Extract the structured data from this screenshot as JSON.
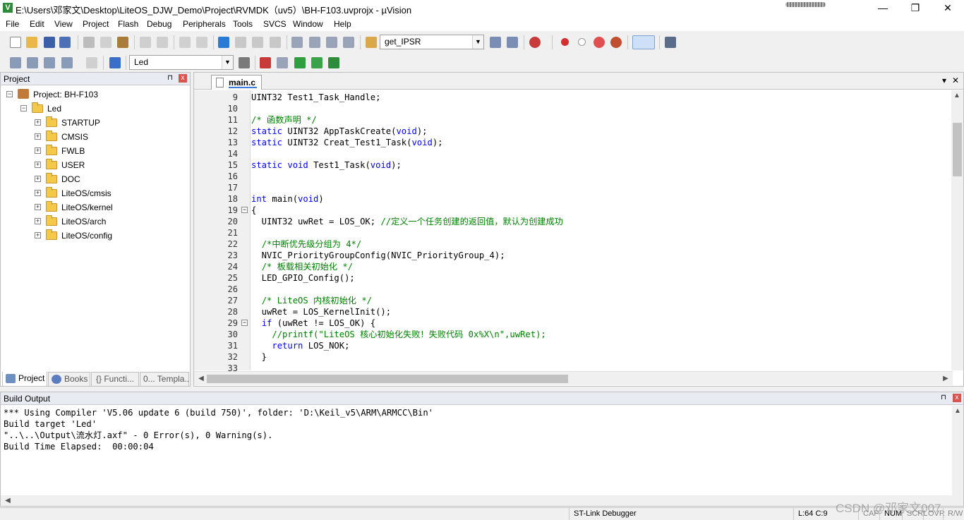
{
  "window": {
    "app_icon": "V",
    "title": "E:\\Users\\邓家文\\Desktop\\LiteOS_DJW_Demo\\Project\\RVMDK（uv5）\\BH-F103.uvprojx - µVision",
    "minimize": "—",
    "restore": "❐",
    "close": "✕"
  },
  "menu": [
    "File",
    "Edit",
    "View",
    "Project",
    "Flash",
    "Debug",
    "Peripherals",
    "Tools",
    "SVCS",
    "Window",
    "Help"
  ],
  "toolbar1": {
    "find_combo_value": "get_IPSR",
    "icons": [
      "new-file-icon",
      "open-file-icon",
      "save-icon",
      "save-all-icon",
      "cut-icon",
      "copy-icon",
      "paste-icon",
      "undo-icon",
      "redo-icon",
      "nav-back-icon",
      "nav-forward-icon",
      "bookmark-icon",
      "prev-bookmark-icon",
      "next-bookmark-icon",
      "clear-bookmarks-icon",
      "indent-icon",
      "unindent-icon",
      "comment-icon",
      "uncomment-icon",
      "find-in-files-icon",
      "debug-icon",
      "breakpoint-icon",
      "disable-breakpoint-icon",
      "kill-breakpoints-icon",
      "window-layout-icon",
      "configure-icon"
    ]
  },
  "toolbar2": {
    "target_combo_value": "Led",
    "icons": [
      "translate-icon",
      "build-icon",
      "rebuild-icon",
      "batch-build-icon",
      "stop-build-icon",
      "download-icon",
      "target-options-icon",
      "manage-components-icon",
      "select-packs-icon",
      "pack-installer-icon"
    ]
  },
  "project_panel": {
    "title": "Project",
    "pin": "⊓",
    "close": "x",
    "root": "Project: BH-F103",
    "target": "Led",
    "groups": [
      "STARTUP",
      "CMSIS",
      "FWLB",
      "USER",
      "DOC",
      "LiteOS/cmsis",
      "LiteOS/kernel",
      "LiteOS/arch",
      "LiteOS/config"
    ],
    "tabs": [
      "Project",
      "Books",
      "{} Functi...",
      "0... Templa..."
    ]
  },
  "editor": {
    "tab_label": "main.c",
    "dropdown": "▾",
    "close": "✕",
    "lines": [
      {
        "num": "9",
        "fold": "",
        "segs": [
          {
            "t": "UINT32 Test1_Task_Handle;",
            "c": ""
          }
        ]
      },
      {
        "num": "10",
        "fold": "",
        "segs": []
      },
      {
        "num": "11",
        "fold": "",
        "segs": [
          {
            "t": "/* 函数声明 */",
            "c": "cm"
          }
        ]
      },
      {
        "num": "12",
        "fold": "",
        "segs": [
          {
            "t": "static",
            "c": "kw"
          },
          {
            "t": " UINT32 AppTaskCreate(",
            "c": ""
          },
          {
            "t": "void",
            "c": "kw"
          },
          {
            "t": ");",
            "c": ""
          }
        ]
      },
      {
        "num": "13",
        "fold": "",
        "segs": [
          {
            "t": "static",
            "c": "kw"
          },
          {
            "t": " UINT32 Creat_Test1_Task(",
            "c": ""
          },
          {
            "t": "void",
            "c": "kw"
          },
          {
            "t": ");",
            "c": ""
          }
        ]
      },
      {
        "num": "14",
        "fold": "",
        "segs": []
      },
      {
        "num": "15",
        "fold": "",
        "segs": [
          {
            "t": "static",
            "c": "kw"
          },
          {
            "t": " ",
            "c": ""
          },
          {
            "t": "void",
            "c": "kw"
          },
          {
            "t": " Test1_Task(",
            "c": ""
          },
          {
            "t": "void",
            "c": "kw"
          },
          {
            "t": ");",
            "c": ""
          }
        ]
      },
      {
        "num": "16",
        "fold": "",
        "segs": []
      },
      {
        "num": "17",
        "fold": "",
        "segs": []
      },
      {
        "num": "18",
        "fold": "",
        "segs": [
          {
            "t": "int",
            "c": "kw"
          },
          {
            "t": " main(",
            "c": ""
          },
          {
            "t": "void",
            "c": "kw"
          },
          {
            "t": ")",
            "c": ""
          }
        ]
      },
      {
        "num": "19",
        "fold": "−",
        "segs": [
          {
            "t": "{",
            "c": ""
          }
        ]
      },
      {
        "num": "20",
        "fold": "",
        "segs": [
          {
            "t": "  UINT32 uwRet = LOS_OK; ",
            "c": ""
          },
          {
            "t": "//定义一个任务创建的返回值，默认为创建成功",
            "c": "cm"
          }
        ]
      },
      {
        "num": "21",
        "fold": "",
        "segs": []
      },
      {
        "num": "22",
        "fold": "",
        "segs": [
          {
            "t": "  ",
            "c": ""
          },
          {
            "t": "/*中断优先级分组为 4*/",
            "c": "cm"
          }
        ]
      },
      {
        "num": "23",
        "fold": "",
        "segs": [
          {
            "t": "  NVIC_PriorityGroupConfig(NVIC_PriorityGroup_4);",
            "c": ""
          }
        ]
      },
      {
        "num": "24",
        "fold": "",
        "segs": [
          {
            "t": "  ",
            "c": ""
          },
          {
            "t": "/* 板载相关初始化 */",
            "c": "cm"
          }
        ]
      },
      {
        "num": "25",
        "fold": "",
        "segs": [
          {
            "t": "  LED_GPIO_Config();",
            "c": ""
          }
        ]
      },
      {
        "num": "26",
        "fold": "",
        "segs": []
      },
      {
        "num": "27",
        "fold": "",
        "segs": [
          {
            "t": "  ",
            "c": ""
          },
          {
            "t": "/* LiteOS 内核初始化 */",
            "c": "cm"
          }
        ]
      },
      {
        "num": "28",
        "fold": "",
        "segs": [
          {
            "t": "  uwRet = LOS_KernelInit();",
            "c": ""
          }
        ]
      },
      {
        "num": "29",
        "fold": "−",
        "segs": [
          {
            "t": "  ",
            "c": ""
          },
          {
            "t": "if",
            "c": "kw"
          },
          {
            "t": " (uwRet != LOS_OK) {",
            "c": ""
          }
        ]
      },
      {
        "num": "30",
        "fold": "",
        "segs": [
          {
            "t": "    ",
            "c": ""
          },
          {
            "t": "//printf(\"LiteOS 核心初始化失败！失败代码 0x%X\\n\",uwRet);",
            "c": "cm"
          }
        ]
      },
      {
        "num": "31",
        "fold": "",
        "segs": [
          {
            "t": "    ",
            "c": ""
          },
          {
            "t": "return",
            "c": "kw"
          },
          {
            "t": " LOS_NOK;",
            "c": ""
          }
        ]
      },
      {
        "num": "32",
        "fold": "",
        "segs": [
          {
            "t": "  }",
            "c": ""
          }
        ]
      },
      {
        "num": "33",
        "fold": "",
        "segs": []
      }
    ]
  },
  "build_output": {
    "title": "Build Output",
    "pin": "⊓",
    "close": "x",
    "lines": [
      "*** Using Compiler 'V5.06 update 6 (build 750)', folder: 'D:\\Keil_v5\\ARM\\ARMCC\\Bin'",
      "Build target 'Led'",
      "\"..\\..\\Output\\流水灯.axf\" - 0 Error(s), 0 Warning(s).",
      "Build Time Elapsed:  00:00:04"
    ]
  },
  "statusbar": {
    "debugger": "ST-Link Debugger",
    "position": "L:64 C:9",
    "caps": "CAP",
    "num": "NUM",
    "scrl": "SCRL",
    "ovr": "OVR",
    "rw": "R/W"
  },
  "watermark": "CSDN @邓家文007",
  "colors": {
    "keyword": "#0000ff",
    "comment": "#008000",
    "breakpoint": "#d32f2f",
    "folder": "#f3c94c"
  }
}
